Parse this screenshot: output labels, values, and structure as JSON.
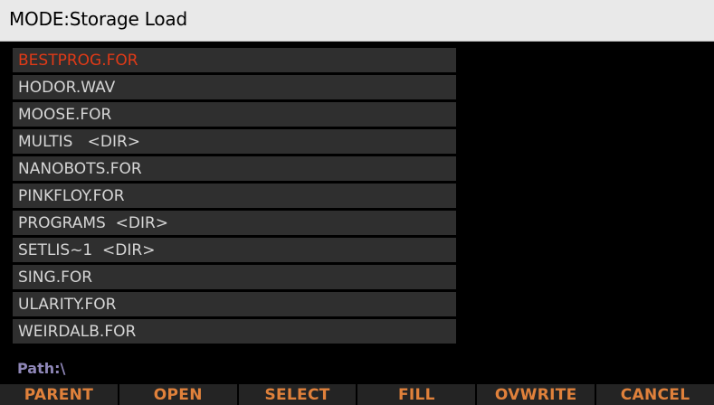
{
  "header": {
    "title": "MODE:Storage Load"
  },
  "files": [
    {
      "name": "BESTPROG.FOR",
      "selected": true
    },
    {
      "name": "HODOR.WAV",
      "selected": false
    },
    {
      "name": "MOOSE.FOR",
      "selected": false
    },
    {
      "name": "MULTIS   <DIR>",
      "selected": false
    },
    {
      "name": "NANOBOTS.FOR",
      "selected": false
    },
    {
      "name": "PINKFLOY.FOR",
      "selected": false
    },
    {
      "name": "PROGRAMS  <DIR>",
      "selected": false
    },
    {
      "name": "SETLIS~1  <DIR>",
      "selected": false
    },
    {
      "name": "SING.FOR",
      "selected": false
    },
    {
      "name": "ULARITY.FOR",
      "selected": false
    },
    {
      "name": "WEIRDALB.FOR",
      "selected": false
    }
  ],
  "path": {
    "label": "Path:\\"
  },
  "softkeys": [
    "PARENT",
    "OPEN",
    "SELECT",
    "FILL",
    "OVWRITE",
    "CANCEL"
  ],
  "colors": {
    "header_bg": "#e9e9e9",
    "row_bg": "#2f2f2f",
    "row_text": "#d6d6d6",
    "selected_text": "#e03a17",
    "path_text": "#8f87b8",
    "softkey_text": "#e0813b"
  }
}
